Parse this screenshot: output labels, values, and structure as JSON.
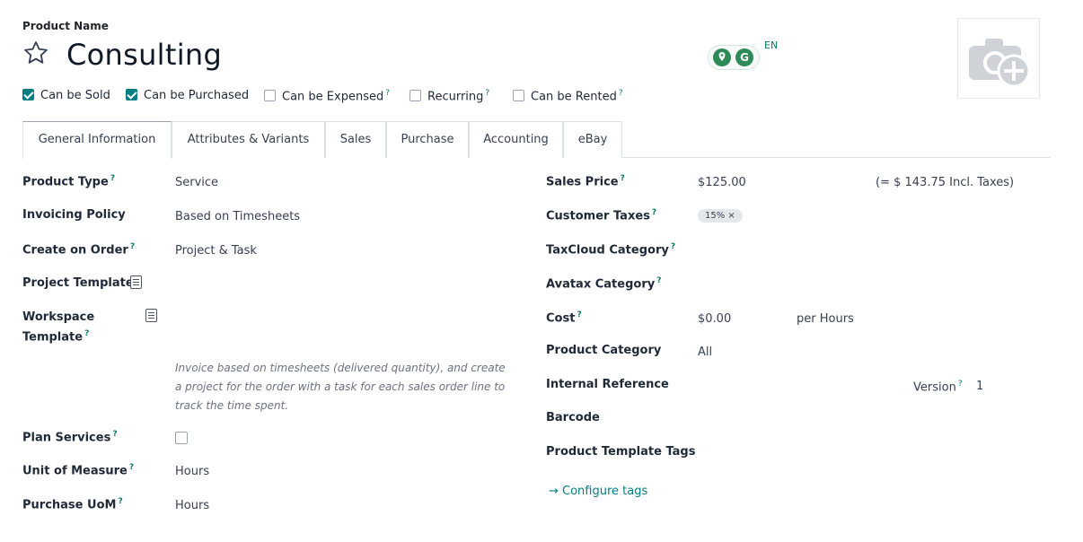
{
  "header": {
    "product_name_label": "Product Name",
    "title": "Consulting",
    "language": "EN",
    "star_icon": "star-outline-icon",
    "photo_icon": "camera-add-icon"
  },
  "options": [
    {
      "label": "Can be Sold",
      "checked": true,
      "help": false
    },
    {
      "label": "Can be Purchased",
      "checked": true,
      "help": false
    },
    {
      "label": "Can be Expensed",
      "checked": false,
      "help": true
    },
    {
      "label": "Recurring",
      "checked": false,
      "help": true
    },
    {
      "label": "Can be Rented",
      "checked": false,
      "help": true
    }
  ],
  "help_mark": "?",
  "tabs": [
    "General Information",
    "Attributes & Variants",
    "Sales",
    "Purchase",
    "Accounting",
    "eBay"
  ],
  "left": {
    "product_type": {
      "label": "Product Type",
      "value": "Service"
    },
    "invoicing_policy": {
      "label": "Invoicing Policy",
      "value": "Based on Timesheets"
    },
    "create_on_order": {
      "label": "Create on Order",
      "value": "Project & Task"
    },
    "project_template": {
      "label": "Project Template"
    },
    "workspace_template": {
      "label_line1": "Workspace",
      "label_line2": "Template"
    },
    "help_text": {
      "line1": "Invoice based on timesheets (delivered quantity), and create",
      "line2": "a project for the order with a task for each sales order line to",
      "line3": "track the time spent."
    },
    "plan_services": {
      "label": "Plan Services",
      "checked": false
    },
    "unit_of_measure": {
      "label": "Unit of Measure",
      "value": "Hours"
    },
    "purchase_uom": {
      "label": "Purchase UoM",
      "value": "Hours"
    }
  },
  "right": {
    "sales_price": {
      "label": "Sales Price",
      "value": "$125.00",
      "incl_taxes": "(= $ 143.75 Incl. Taxes)"
    },
    "customer_taxes": {
      "label": "Customer Taxes",
      "badge": "15% ×"
    },
    "taxcloud_category": {
      "label": "TaxCloud Category"
    },
    "avatax_category": {
      "label": "Avatax Category"
    },
    "cost": {
      "label": "Cost",
      "value": "$0.00",
      "per": "per Hours"
    },
    "product_category": {
      "label": "Product Category",
      "value": "All"
    },
    "internal_reference": {
      "label": "Internal Reference",
      "version_label": "Version",
      "version_value": "1"
    },
    "barcode": {
      "label": "Barcode"
    },
    "product_template_tags": {
      "label": "Product Template Tags"
    },
    "configure_tags": "→ Configure tags"
  },
  "colors": {
    "accent": "#017e84",
    "brand_green": "#2e8b57"
  }
}
